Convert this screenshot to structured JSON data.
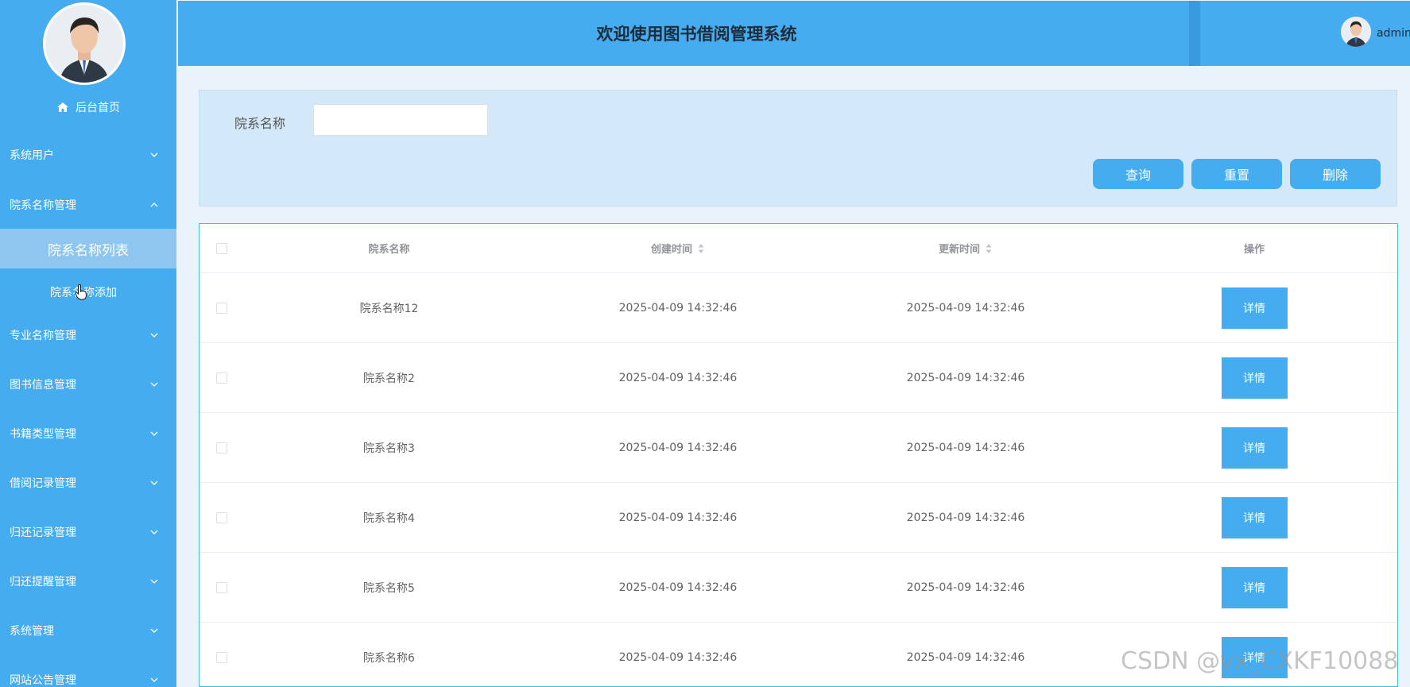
{
  "header": {
    "title": "欢迎使用图书借阅管理系统",
    "username": "admin"
  },
  "sidebar": {
    "home": "后台首页",
    "menu": [
      {
        "label": "系统用户",
        "expanded": false
      },
      {
        "label": "院系名称管理",
        "expanded": true
      },
      {
        "label": "专业名称管理",
        "expanded": false
      },
      {
        "label": "图书信息管理",
        "expanded": false
      },
      {
        "label": "书籍类型管理",
        "expanded": false
      },
      {
        "label": "借阅记录管理",
        "expanded": false
      },
      {
        "label": "归还记录管理",
        "expanded": false
      },
      {
        "label": "归还提醒管理",
        "expanded": false
      },
      {
        "label": "系统管理",
        "expanded": false
      },
      {
        "label": "网站公告管理",
        "expanded": false
      }
    ],
    "submenu": {
      "active": "院系名称列表",
      "add": "院系名称添加"
    }
  },
  "search": {
    "label": "院系名称",
    "value": "",
    "placeholder": "",
    "query_button": "查询",
    "reset_button": "重置",
    "delete_button": "删除"
  },
  "table": {
    "columns": [
      "院系名称",
      "创建时间",
      "更新时间",
      "操作"
    ],
    "rows": [
      {
        "name": "院系名称12",
        "created": "2025-04-09 14:32:46",
        "updated": "2025-04-09 14:32:46",
        "action": "详情"
      },
      {
        "name": "院系名称2",
        "created": "2025-04-09 14:32:46",
        "updated": "2025-04-09 14:32:46",
        "action": "详情"
      },
      {
        "name": "院系名称3",
        "created": "2025-04-09 14:32:46",
        "updated": "2025-04-09 14:32:46",
        "action": "详情"
      },
      {
        "name": "院系名称4",
        "created": "2025-04-09 14:32:46",
        "updated": "2025-04-09 14:32:46",
        "action": "详情"
      },
      {
        "name": "院系名称5",
        "created": "2025-04-09 14:32:46",
        "updated": "2025-04-09 14:32:46",
        "action": "详情"
      },
      {
        "name": "院系名称6",
        "created": "2025-04-09 14:32:46",
        "updated": "2025-04-09 14:32:46",
        "action": "详情"
      }
    ]
  },
  "watermark": "CSDN @vx_CXKF10088",
  "colors": {
    "primary": "#45acef",
    "sidebar_active": "#8ec6f0",
    "panel_bg": "#d3e9f9",
    "table_border": "#3fc2d6"
  }
}
